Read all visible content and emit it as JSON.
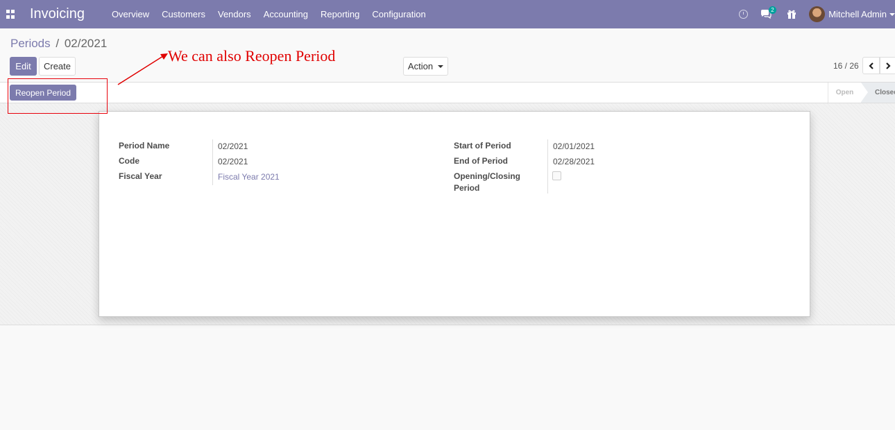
{
  "navbar": {
    "app_name": "Invoicing",
    "menu": [
      "Overview",
      "Customers",
      "Vendors",
      "Accounting",
      "Reporting",
      "Configuration"
    ],
    "chat_badge": "2",
    "user_name": "Mitchell Admin",
    "icons": [
      "apps-grid-icon",
      "clock-icon",
      "chat-icon",
      "gift-icon",
      "avatar"
    ],
    "color": "#7c7bad"
  },
  "breadcrumb": {
    "parent": "Periods",
    "separator": "/",
    "current": "02/2021"
  },
  "buttons": {
    "edit": "Edit",
    "create": "Create",
    "action": "Action",
    "reopen": "Reopen Period"
  },
  "pager": {
    "value": "16 / 26"
  },
  "status": {
    "stages": [
      "Open",
      "Closed"
    ],
    "active": "Closed"
  },
  "form": {
    "left": [
      {
        "label": "Period Name",
        "value": "02/2021"
      },
      {
        "label": "Code",
        "value": "02/2021"
      },
      {
        "label": "Fiscal Year",
        "value": "Fiscal Year 2021"
      }
    ],
    "right": [
      {
        "label": "Start of Period",
        "value": "02/01/2021"
      },
      {
        "label": "End of Period",
        "value": "02/28/2021"
      },
      {
        "label": "Opening/Closing Period",
        "value": ""
      }
    ],
    "opening_closing_checked": false
  },
  "annotation": {
    "text": "We can also Reopen Period",
    "color": "#e00000"
  }
}
